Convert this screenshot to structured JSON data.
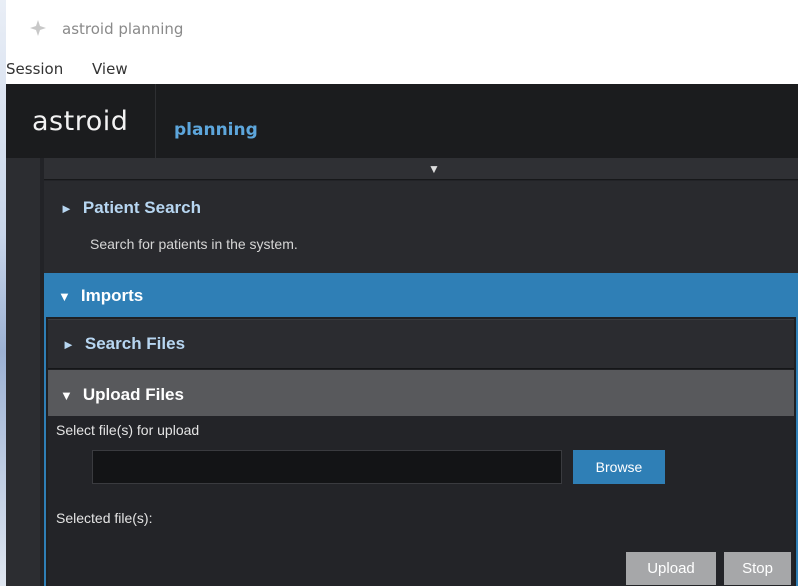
{
  "window": {
    "title": "astroid planning",
    "icon": "diamond-icon"
  },
  "menu": {
    "items": [
      "Session",
      "View"
    ]
  },
  "app": {
    "logo": "astroid",
    "label": "planning"
  },
  "collapse_toggle": {
    "icon": "triangle-down-icon",
    "glyph": "▼"
  },
  "sections": {
    "patient_search": {
      "title": "Patient Search",
      "description": "Search for patients in the system.",
      "glyph": "►"
    },
    "imports": {
      "title": "Imports",
      "glyph": "▼",
      "search_files": {
        "title": "Search Files",
        "glyph": "►"
      },
      "upload_files": {
        "title": "Upload Files",
        "glyph": "▼",
        "select_label": "Select file(s) for upload",
        "file_input_value": "",
        "browse_label": "Browse",
        "selected_label": "Selected file(s):",
        "upload_label": "Upload",
        "stop_label": "Stop"
      }
    }
  },
  "colors": {
    "accent": "#2f7fb6",
    "app_bar": "#1b1c1e",
    "section_title": "#b7d6f1",
    "disabled_button": "#a6a7a9"
  }
}
